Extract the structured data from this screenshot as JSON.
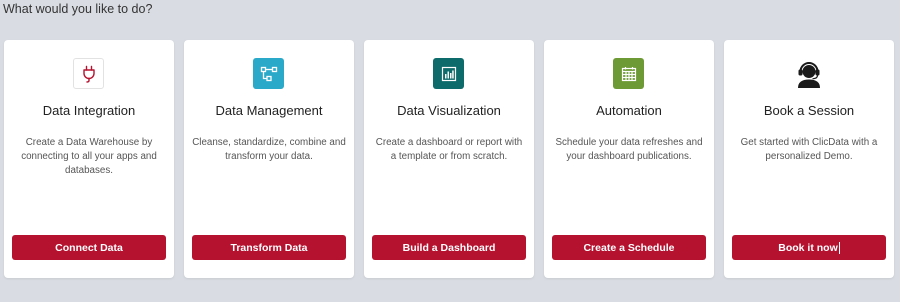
{
  "prompt": "What would you like to do?",
  "colors": {
    "button": "#b5122f",
    "page_background": "#d9dde3",
    "card_background": "#ffffff"
  },
  "cards": [
    {
      "icon": "plug-icon",
      "icon_color": "#b5122f",
      "title": "Data Integration",
      "description": "Create a Data Warehouse by connecting to all your apps and databases.",
      "button": "Connect Data"
    },
    {
      "icon": "flow-nodes-icon",
      "icon_color": "#2aa9c9",
      "title": "Data Management",
      "description": "Cleanse, standardize, combine and transform your data.",
      "button": "Transform Data"
    },
    {
      "icon": "bar-chart-icon",
      "icon_color": "#0e6b6b",
      "title": "Data Visualization",
      "description": "Create a dashboard or report with a template or from scratch.",
      "button": "Build a Dashboard"
    },
    {
      "icon": "calendar-icon",
      "icon_color": "#6e9a35",
      "title": "Automation",
      "description": "Schedule your data refreshes and your dashboard publications.",
      "button": "Create a Schedule"
    },
    {
      "icon": "support-agent-icon",
      "icon_color": "#1a1a1a",
      "title": "Book a Session",
      "description": "Get started with ClicData with a personalized Demo.",
      "button": "Book it now"
    }
  ]
}
